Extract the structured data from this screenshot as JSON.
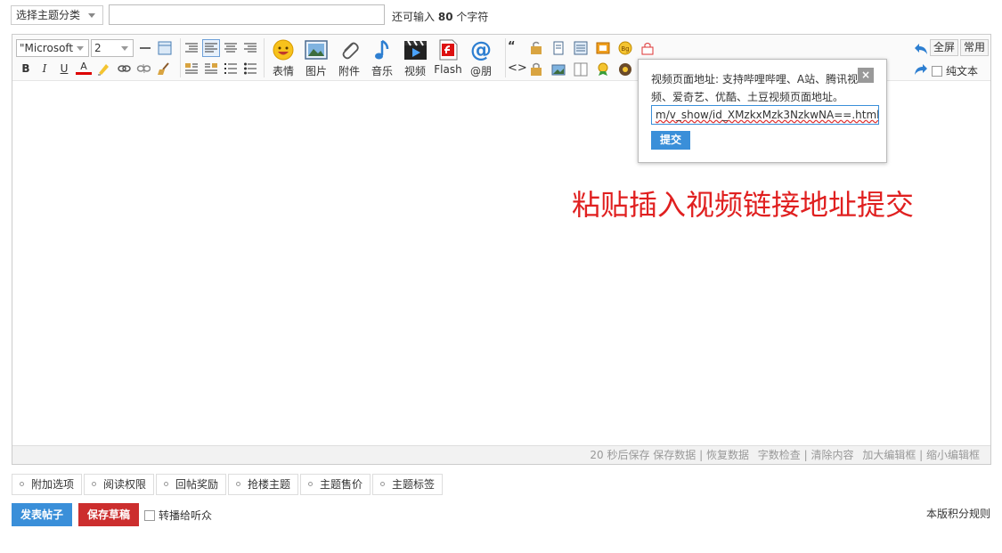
{
  "top": {
    "topic_select": "选择主题分类",
    "char_hint_prefix": "还可输入",
    "char_hint_count": "80",
    "char_hint_suffix": "个字符"
  },
  "toolbar": {
    "font_family": "\"Microsoft",
    "font_size": "2",
    "bold": "B",
    "italic": "I",
    "underline": "U",
    "font_color": "A",
    "buttons": [
      {
        "label": "表情",
        "icon": "emoticon-icon"
      },
      {
        "label": "图片",
        "icon": "image-icon"
      },
      {
        "label": "附件",
        "icon": "attachment-icon"
      },
      {
        "label": "音乐",
        "icon": "music-icon"
      },
      {
        "label": "视频",
        "icon": "video-icon"
      },
      {
        "label": "Flash",
        "icon": "flash-icon"
      },
      {
        "label": "@朋",
        "icon": "at-icon"
      }
    ],
    "fullscreen": "全屏",
    "common": "常用",
    "plain_text": "纯文本"
  },
  "popup": {
    "text": "视频页面地址: 支持哔哩哔哩、A站、腾讯视频、爱奇艺、优酷、土豆视频页面地址。",
    "close": "×",
    "input_value": "m/v_show/id_XMzkxMzk3NzkwNA==.html",
    "submit": "提交"
  },
  "annotation": "粘贴插入视频链接地址提交",
  "statusbar": {
    "autosave": "20 秒后保存 保存数据 | 恢复数据",
    "wordcount": "字数检查 | 清除内容",
    "resize": "加大编辑框 | 缩小编辑框"
  },
  "options": [
    "附加选项",
    "阅读权限",
    "回帖奖励",
    "抢楼主题",
    "主题售价",
    "主题标签"
  ],
  "actions": {
    "post": "发表帖子",
    "draft": "保存草稿",
    "broadcast": "转播给听众",
    "credit_rules": "本版积分规则"
  },
  "colors": {
    "primary": "#3a8fd9",
    "danger": "#cc2e2e",
    "annotation": "#e02020"
  }
}
